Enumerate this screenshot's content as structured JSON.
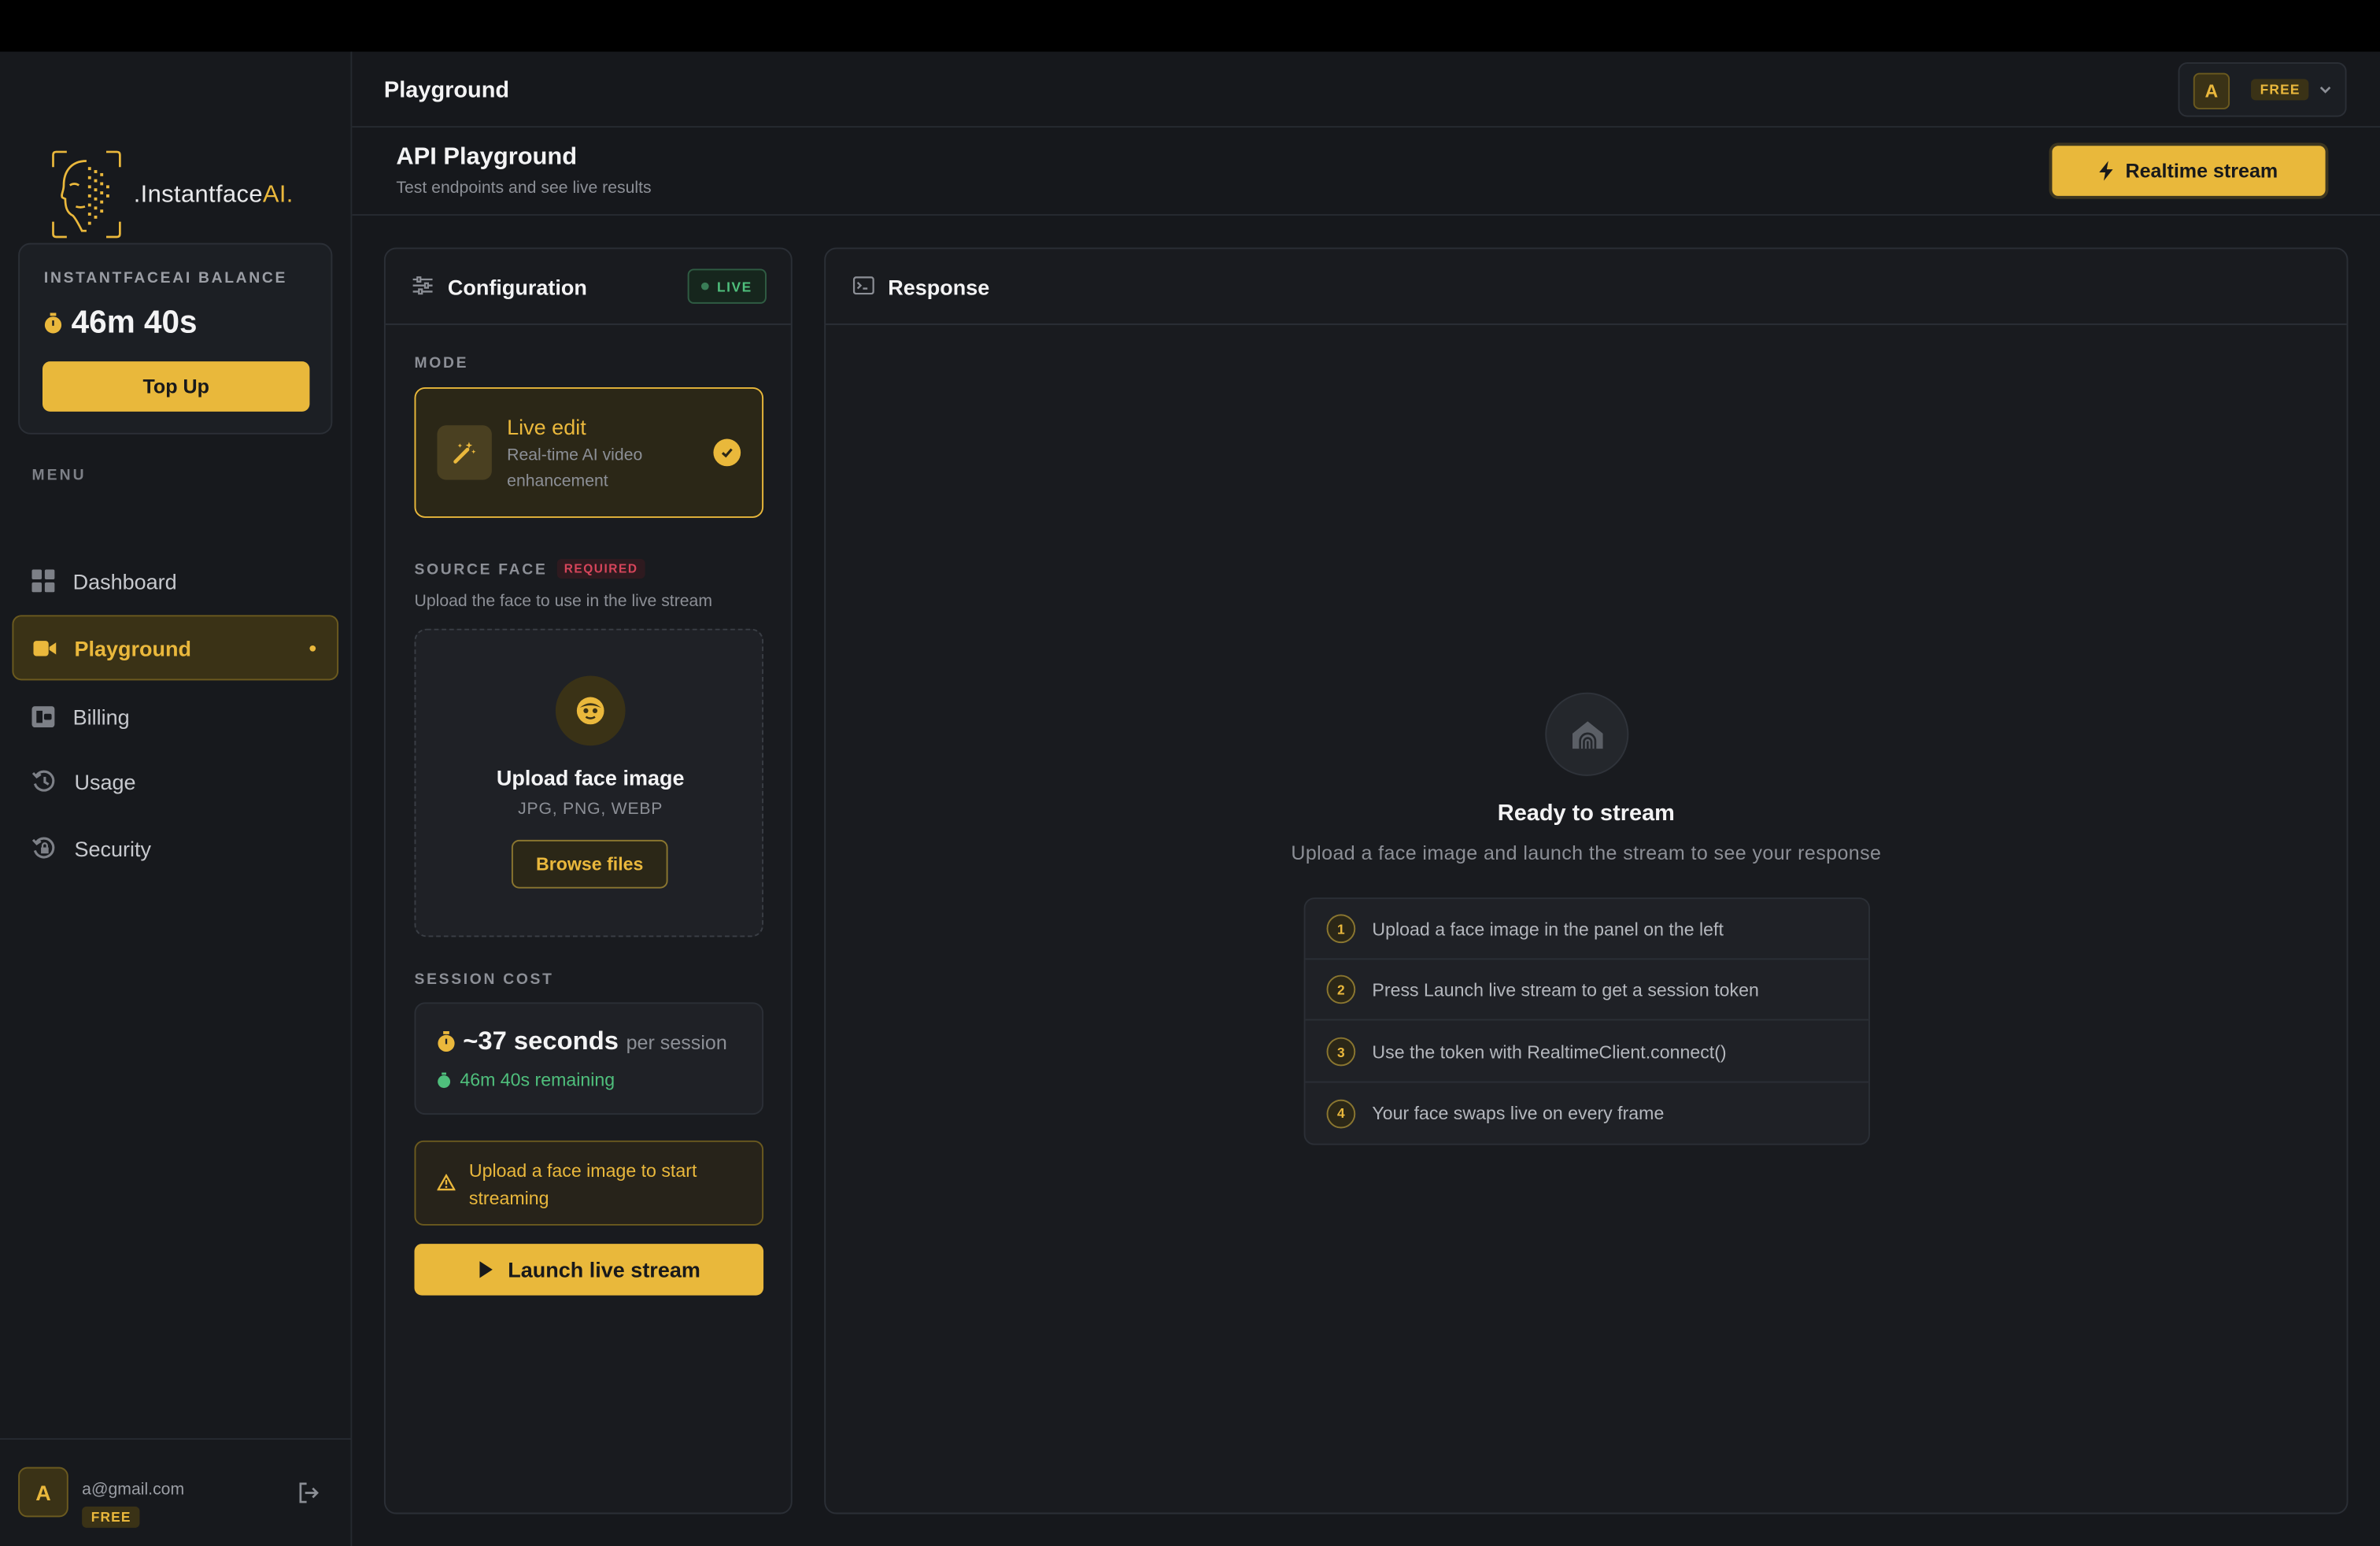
{
  "brand": {
    "prefix": ".Instantface",
    "suffix": "AI."
  },
  "balance": {
    "label": "INSTANTFACEAI BALANCE",
    "value": "46m 40s",
    "topup_label": "Top Up"
  },
  "sidebar": {
    "menu_label": "MENU",
    "items": [
      {
        "label": "Dashboard",
        "icon": "grid-icon"
      },
      {
        "label": "Playground",
        "icon": "video-camera-icon",
        "active": true
      },
      {
        "label": "Billing",
        "icon": "wallet-icon"
      },
      {
        "label": "Usage",
        "icon": "history-icon"
      },
      {
        "label": "Security",
        "icon": "shield-lock-icon"
      }
    ]
  },
  "user": {
    "avatar_letter": "A",
    "email": "a@gmail.com",
    "plan": "FREE"
  },
  "topbar": {
    "title": "Playground",
    "avatar_letter": "A",
    "plan": "FREE"
  },
  "header": {
    "title": "API Playground",
    "subtitle": "Test endpoints and see live results",
    "realtime_label": "Realtime stream"
  },
  "config": {
    "title": "Configuration",
    "status": "LIVE",
    "mode_label": "MODE",
    "mode": {
      "title": "Live edit",
      "description": "Real-time AI video enhancement"
    },
    "source_label": "SOURCE FACE",
    "required_label": "REQUIRED",
    "source_desc": "Upload the face to use in the live stream",
    "upload": {
      "title": "Upload face image",
      "types": "JPG, PNG, WEBP",
      "browse_label": "Browse files"
    },
    "cost_label": "SESSION COST",
    "cost": {
      "value": "~37 seconds",
      "per": "per session",
      "remaining": "46m 40s remaining"
    },
    "warning": "Upload a face image to start streaming",
    "launch_label": "Launch live stream"
  },
  "response": {
    "title": "Response",
    "ready_title": "Ready to stream",
    "ready_desc": "Upload a face image and launch the stream to see your response",
    "steps": [
      {
        "num": "1",
        "text": "Upload a face image in the panel on the left"
      },
      {
        "num": "2",
        "text": "Press Launch live stream to get a session token"
      },
      {
        "num": "3",
        "text": "Use the token with RealtimeClient.connect()"
      },
      {
        "num": "4",
        "text": "Your face swaps live on every frame"
      }
    ]
  },
  "colors": {
    "accent": "#e9b83b",
    "success": "#4fbf7c",
    "danger": "#d6455b",
    "background": "#16181c"
  }
}
